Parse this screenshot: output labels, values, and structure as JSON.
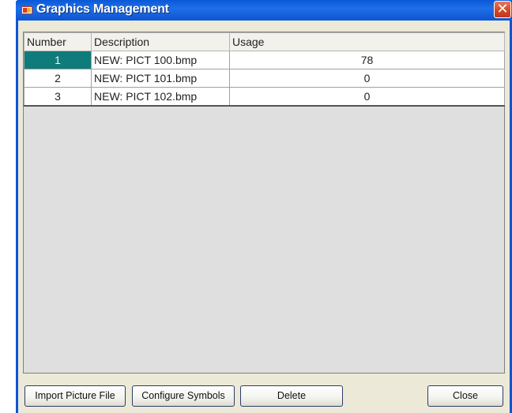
{
  "window": {
    "title": "Graphics Management",
    "close_glyph": "✕"
  },
  "table": {
    "headers": [
      "Number",
      "Description",
      "Usage"
    ],
    "rows": [
      {
        "number": "1",
        "description": "NEW: PICT 100.bmp",
        "usage": "78"
      },
      {
        "number": "2",
        "description": "NEW: PICT 101.bmp",
        "usage": "0"
      },
      {
        "number": "3",
        "description": "NEW: PICT 102.bmp",
        "usage": "0"
      }
    ],
    "selected_row": 0
  },
  "buttons": {
    "import": "Import Picture File",
    "configure": "Configure Symbols",
    "delete": "Delete",
    "close": "Close"
  },
  "colors": {
    "titlebar": "#0d55d2",
    "selection": "#0f7b7b",
    "dialog_bg": "#ece9d8",
    "list_bg": "#dfdfdf"
  }
}
